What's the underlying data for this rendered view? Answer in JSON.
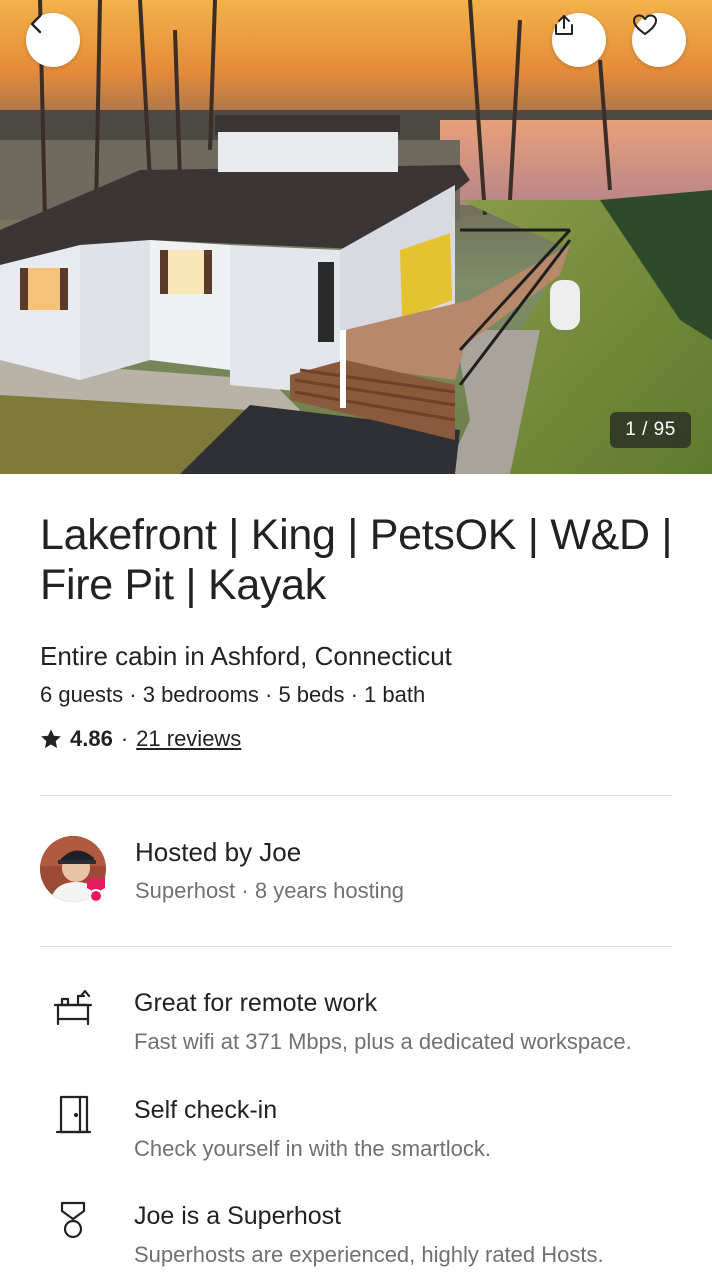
{
  "hero": {
    "photo_counter": "1 / 95",
    "back_icon": "chevron-left-icon",
    "share_icon": "share-icon",
    "favorite_icon": "heart-icon"
  },
  "listing": {
    "title": "Lakefront | King | PetsOK | W&D | Fire Pit | Kayak",
    "subtitle": "Entire cabin in Ashford, Connecticut",
    "details": "6 guests · 3 bedrooms · 5 beds · 1 bath",
    "rating": "4.86",
    "separator": "·",
    "reviews_link": "21 reviews"
  },
  "host": {
    "title": "Hosted by Joe",
    "meta": "Superhost · 8 years hosting"
  },
  "features": [
    {
      "icon": "desk-workspace-icon",
      "title": "Great for remote work",
      "description": "Fast wifi at 371 Mbps, plus a dedicated workspace."
    },
    {
      "icon": "door-icon",
      "title": "Self check-in",
      "description": "Check yourself in with the smartlock."
    },
    {
      "icon": "superhost-medal-icon",
      "title": "Joe is a Superhost",
      "description": "Superhosts are experienced, highly rated Hosts."
    }
  ],
  "colors": {
    "text_primary": "#222222",
    "text_secondary": "#717171",
    "divider": "#dddddd",
    "superhost_badge": "#e31c5f"
  }
}
